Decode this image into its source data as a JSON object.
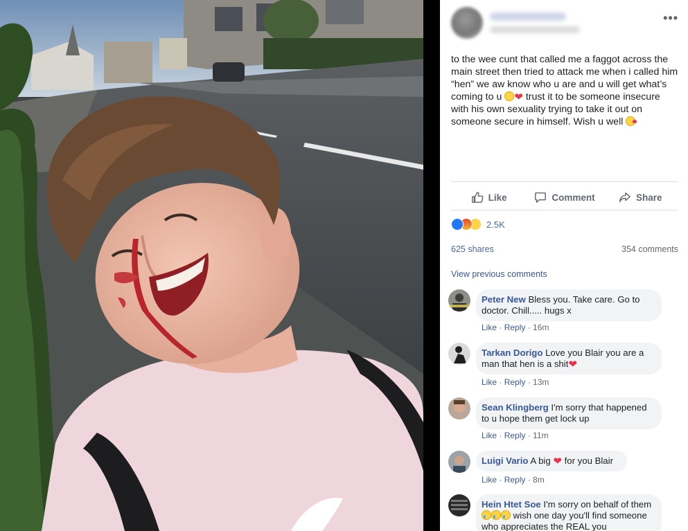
{
  "post": {
    "more_label": "•••",
    "text_parts": {
      "p1": "to the wee cunt that called me a faggot across the main street then tried to attack me when i called him “hen” we aw know who u are and u will get what’s coming to u ",
      "p2": " trust it to be someone insecure with his own sexuality trying to take it out on someone secure in himself. Wish u well "
    },
    "emoji_names": [
      "grinning-face-icon",
      "heart-icon",
      "kissing-face-icon"
    ]
  },
  "actions": {
    "like_label": "Like",
    "comment_label": "Comment",
    "share_label": "Share"
  },
  "stats": {
    "reaction_count": "2.5K",
    "shares": "625 shares",
    "comments": "354 comments",
    "view_previous": "View previous comments"
  },
  "comments": [
    {
      "author": "Peter New",
      "text": "Bless you. Take care. Go to doctor. Chill..... hugs x",
      "like": "Like",
      "reply": "Reply",
      "time": "16m"
    },
    {
      "author": "Tarkan Dorigo",
      "text": "Love you Blair you are a man that hen is a shit",
      "like": "Like",
      "reply": "Reply",
      "time": "13m"
    },
    {
      "author": "Sean Klingberg",
      "text": "I'm sorry that happened to u hope them get lock up",
      "like": "Like",
      "reply": "Reply",
      "time": "11m"
    },
    {
      "author": "Luigi Vario",
      "text_a": "A big ",
      "text_b": " for you Blair",
      "like": "Like",
      "reply": "Reply",
      "time": "8m"
    },
    {
      "author": "Hein Htet Soe",
      "text_a": "I'm sorry on behalf of them",
      "text_b": " wish one day you'll find someone who appreciates the REAL you"
    }
  ],
  "colors": {
    "link": "#385898",
    "secondary": "#606770",
    "bubble": "#f2f3f5",
    "like_blue": "#2078f4",
    "heart_red": "#e8344e"
  }
}
